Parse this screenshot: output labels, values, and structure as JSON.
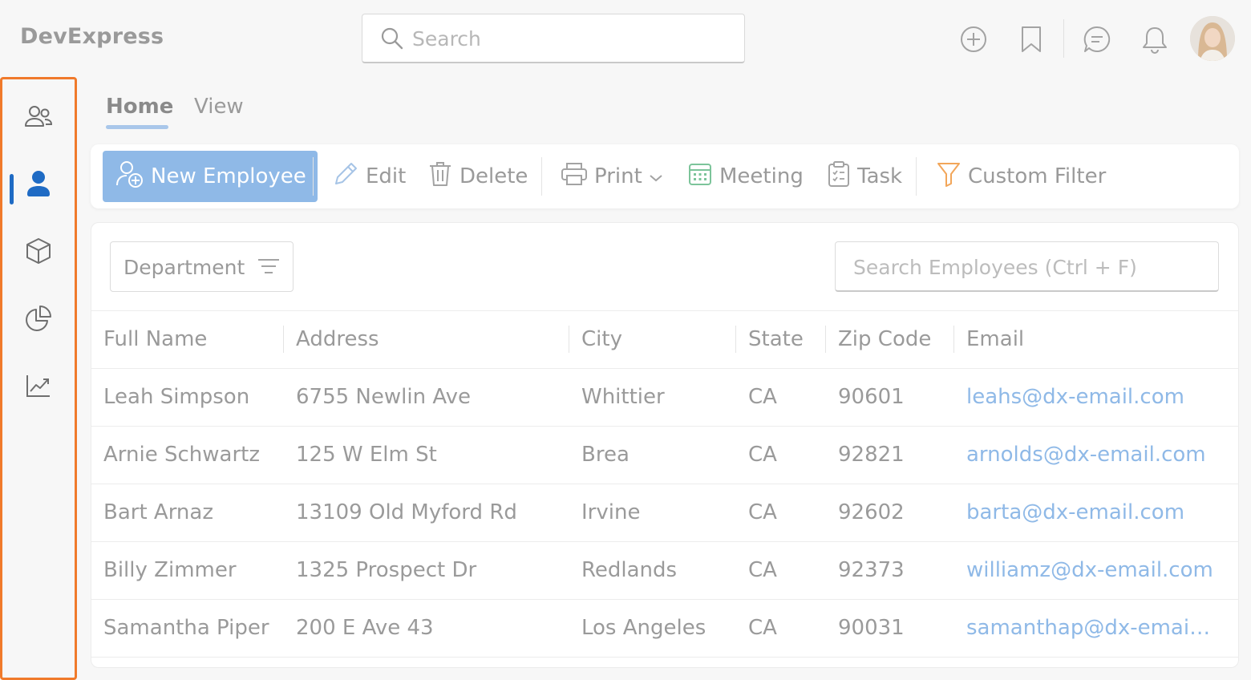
{
  "app": {
    "title": "DevExpress"
  },
  "header": {
    "search_placeholder": "Search",
    "icons": [
      "add-circle-icon",
      "bookmark-icon",
      "chat-icon",
      "bell-icon"
    ]
  },
  "sidebar": {
    "items": [
      {
        "icon": "users-icon",
        "active": false
      },
      {
        "icon": "user-icon",
        "active": true
      },
      {
        "icon": "box-icon",
        "active": false
      },
      {
        "icon": "pie-chart-icon",
        "active": false
      },
      {
        "icon": "trend-chart-icon",
        "active": false
      }
    ]
  },
  "tabs": [
    {
      "label": "Home",
      "active": true
    },
    {
      "label": "View",
      "active": false
    }
  ],
  "toolbar": {
    "new_employee": "New Employee",
    "edit": "Edit",
    "delete": "Delete",
    "print": "Print",
    "meeting": "Meeting",
    "task": "Task",
    "custom_filter": "Custom Filter"
  },
  "grid": {
    "department_label": "Department",
    "search_placeholder": "Search Employees (Ctrl + F)",
    "columns": [
      "Full Name",
      "Address",
      "City",
      "State",
      "Zip Code",
      "Email"
    ],
    "rows": [
      [
        "Leah Simpson",
        "6755 Newlin Ave",
        "Whittier",
        "CA",
        "90601",
        "leahs@dx-email.com"
      ],
      [
        "Arnie Schwartz",
        "125 W Elm St",
        "Brea",
        "CA",
        "92821",
        "arnolds@dx-email.com"
      ],
      [
        "Bart Arnaz",
        "13109 Old Myford Rd",
        "Irvine",
        "CA",
        "92602",
        "barta@dx-email.com"
      ],
      [
        "Billy Zimmer",
        "1325 Prospect Dr",
        "Redlands",
        "CA",
        "92373",
        "williamz@dx-email.com"
      ],
      [
        "Samantha Piper",
        "200 E Ave 43",
        "Los Angeles",
        "CA",
        "90031",
        "samanthap@dx-email.com"
      ]
    ]
  },
  "colors": {
    "accent": "#8fb9e7",
    "active_nav": "#1f6bc4",
    "sidebar_highlight": "#f07a2b",
    "meeting_icon": "#7cc49a",
    "filter_icon": "#f2a65a"
  }
}
